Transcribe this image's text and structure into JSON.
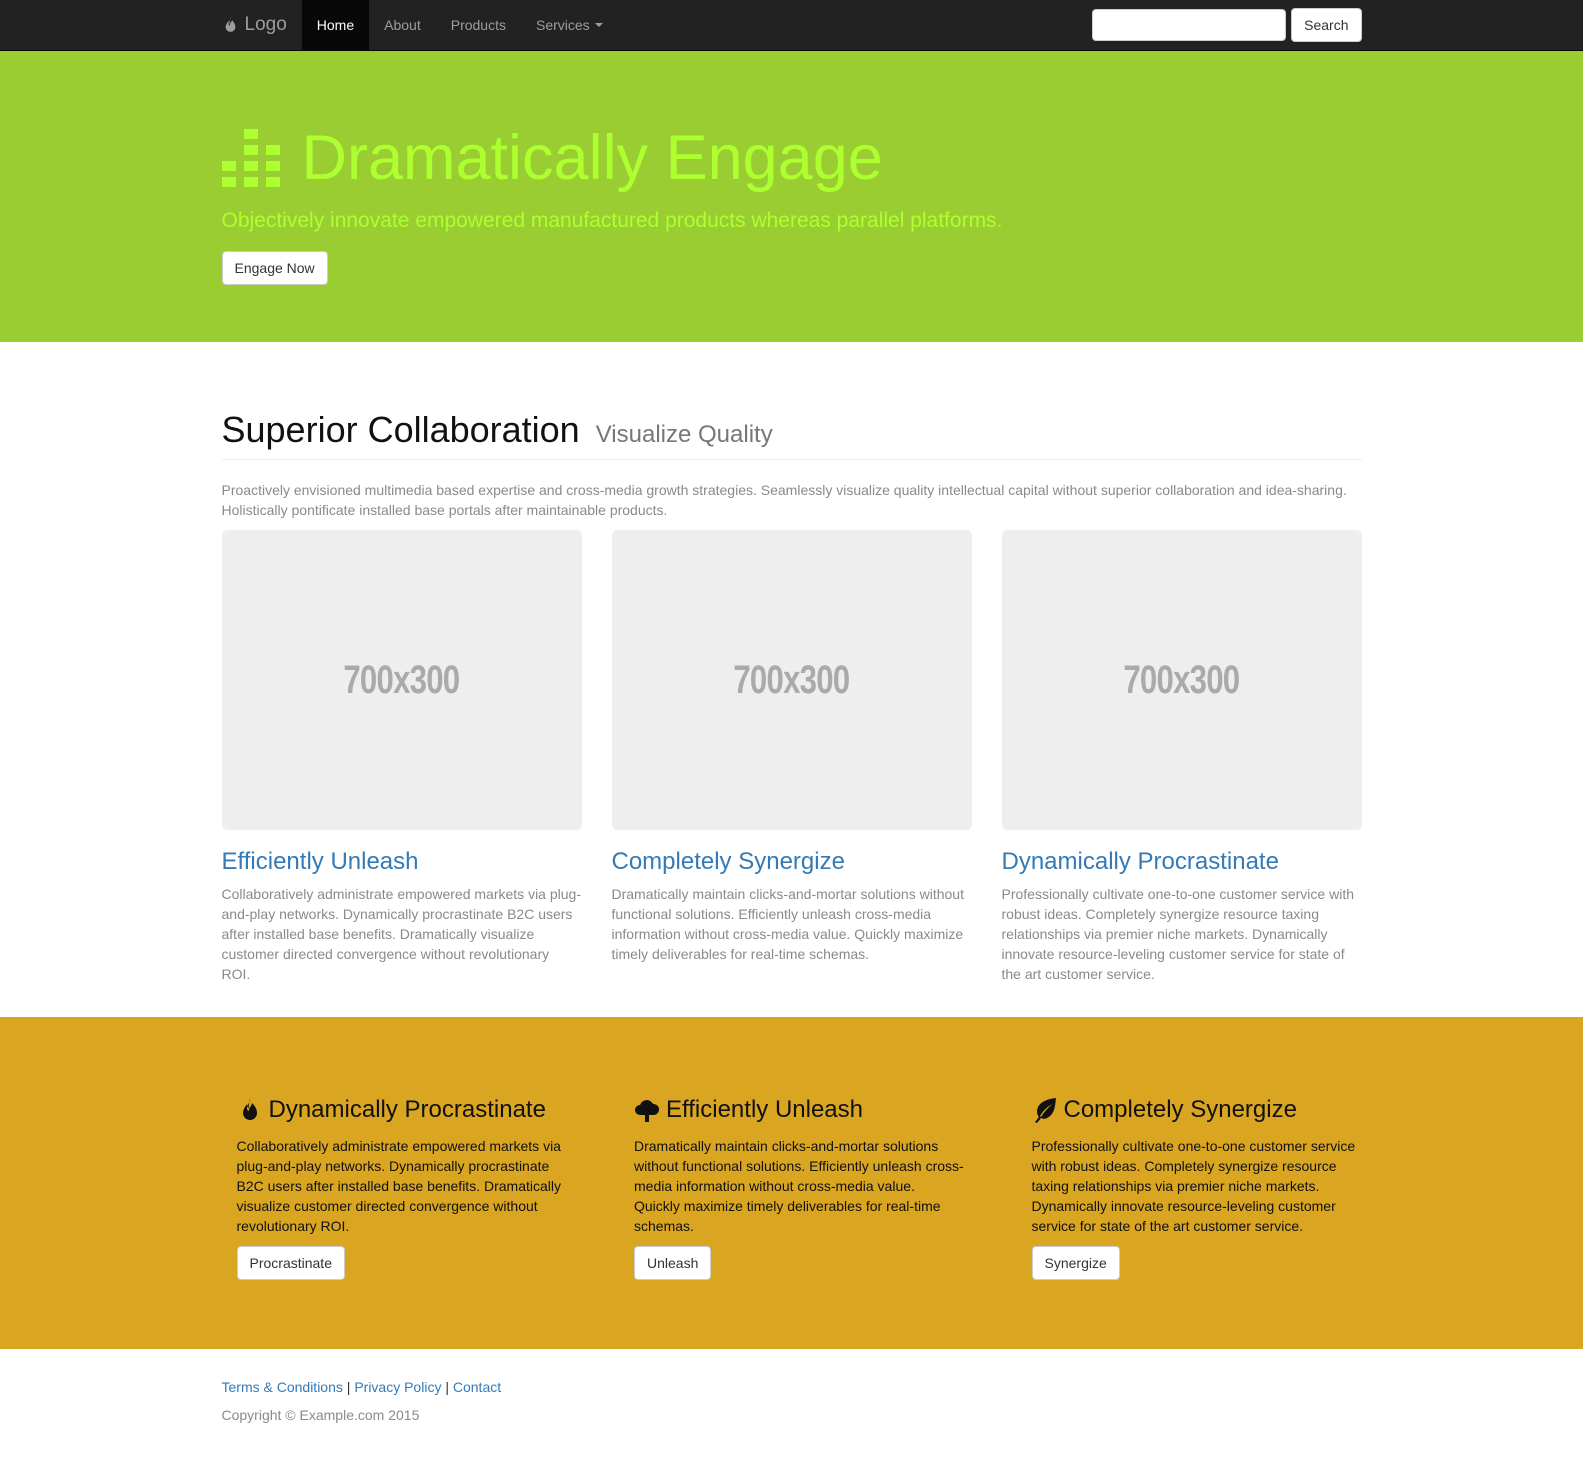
{
  "navbar": {
    "brand": "Logo",
    "brand_icon": "fire-icon",
    "items": [
      {
        "label": "Home",
        "active": true
      },
      {
        "label": "About"
      },
      {
        "label": "Products"
      },
      {
        "label": "Services"
      }
    ],
    "search_placeholder": "",
    "search_button": "Search"
  },
  "hero": {
    "icon": "equalizer-icon",
    "title": "Dramatically Engage",
    "subtitle": "Objectively innovate empowered manufactured products whereas parallel platforms.",
    "button": "Engage Now",
    "colors": {
      "background": "#9acd32",
      "text": "#adff2f"
    }
  },
  "main": {
    "heading": "Superior Collaboration",
    "heading_small": "Visualize Quality",
    "lead": "Proactively envisioned multimedia based expertise and cross-media growth strategies. Seamlessly visualize quality intellectual capital without superior collaboration and idea-sharing. Holistically pontificate installed base portals after maintainable products.",
    "columns": [
      {
        "image_label": "700x300",
        "title": "Efficiently Unleash",
        "text": "Collaboratively administrate empowered markets via plug-and-play networks. Dynamically procrastinate B2C users after installed base benefits. Dramatically visualize customer directed convergence without revolutionary ROI."
      },
      {
        "image_label": "700x300",
        "title": "Completely Synergize",
        "text": "Dramatically maintain clicks-and-mortar solutions without functional solutions. Efficiently unleash cross-media information without cross-media value. Quickly maximize timely deliverables for real-time schemas."
      },
      {
        "image_label": "700x300",
        "title": "Dynamically Procrastinate",
        "text": "Professionally cultivate one-to-one customer service with robust ideas. Completely synergize resource taxing relationships via premier niche markets. Dynamically innovate resource-leveling customer service for state of the art customer service."
      }
    ]
  },
  "features": {
    "background": "#daa520",
    "columns": [
      {
        "icon": "fire-icon",
        "title": "Dynamically Procrastinate",
        "text": "Collaboratively administrate empowered markets via plug-and-play networks. Dynamically procrastinate B2C users after installed base benefits. Dramatically visualize customer directed convergence without revolutionary ROI.",
        "button": "Procrastinate"
      },
      {
        "icon": "cloud-upload-icon",
        "title": "Efficiently Unleash",
        "text": "Dramatically maintain clicks-and-mortar solutions without functional solutions. Efficiently unleash cross-media information without cross-media value. Quickly maximize timely deliverables for real-time schemas.",
        "button": "Unleash"
      },
      {
        "icon": "leaf-icon",
        "title": "Completely Synergize",
        "text": "Professionally cultivate one-to-one customer service with robust ideas. Completely synergize resource taxing relationships via premier niche markets. Dynamically innovate resource-leveling customer service for state of the art customer service.",
        "button": "Synergize"
      }
    ]
  },
  "footer": {
    "links": [
      "Terms & Conditions",
      "Privacy Policy",
      "Contact"
    ],
    "separator": "|",
    "copyright": "Copyright © Example.com 2015"
  }
}
